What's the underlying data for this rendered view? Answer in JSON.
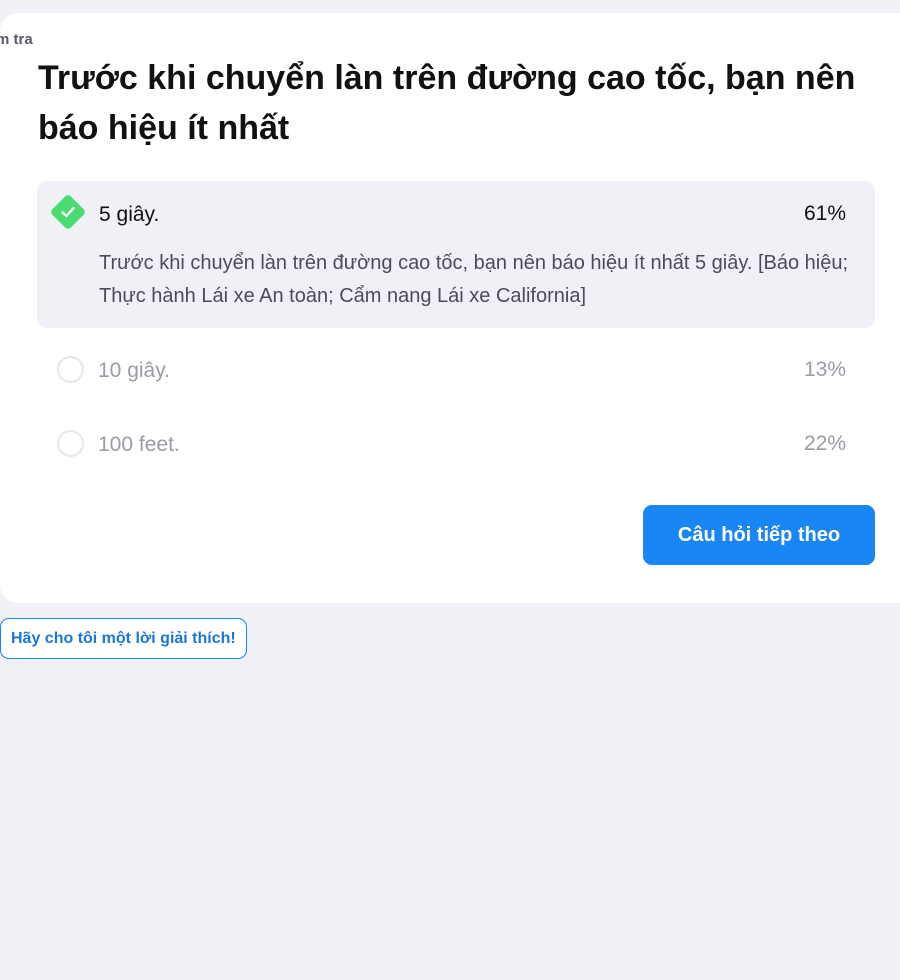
{
  "breadcrumb": "m tra",
  "question": "Trước khi chuyển làn trên đường cao tốc, bạn nên báo hiệu ít nhất",
  "options": [
    {
      "label": "5 giây.",
      "percent": "61%",
      "correct": true,
      "explanation": "Trước khi chuyển làn trên đường cao tốc, bạn nên báo hiệu ít nhất 5 giây. [Báo hiệu; Thực hành Lái xe An toàn; Cẩm nang Lái xe California]"
    },
    {
      "label": "10 giây.",
      "percent": "13%",
      "correct": false
    },
    {
      "label": "100 feet.",
      "percent": "22%",
      "correct": false
    }
  ],
  "next_button": "Câu hỏi tiếp theo",
  "explain_button": "Hãy cho tôi một lời giải thích!",
  "colors": {
    "accent": "#1a86f5",
    "correct": "#49dc6f",
    "background": "#f0f0f6"
  }
}
